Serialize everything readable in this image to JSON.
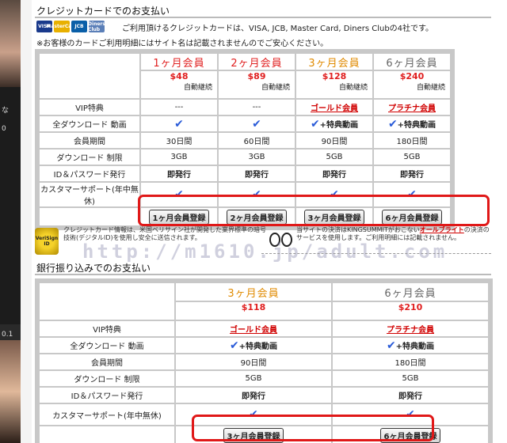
{
  "side": {
    "label_top": "な",
    "label_mid": "0",
    "label_bottom": "0.1"
  },
  "credit": {
    "title": "クレジットカードでのお支払い",
    "card_icons": [
      "VISA",
      "MasterCard",
      "JCB",
      "Diners Club"
    ],
    "intro1": "ご利用頂けるクレジットカードは、VISA, JCB, Master Card, Diners Clubの4社です。",
    "intro2": "※お客様のカードご利用明細にはサイト名は記載されませんのでご安心ください。",
    "plans": [
      {
        "name": "1ヶ月会員",
        "price": "$48",
        "auto": "自動継続",
        "color": "#e02020"
      },
      {
        "name": "2ヶ月会員",
        "price": "$89",
        "auto": "自動継続",
        "color": "#e02020"
      },
      {
        "name": "3ヶ月会員",
        "price": "$128",
        "auto": "自動継続",
        "color": "#e08a00"
      },
      {
        "name": "6ヶ月会員",
        "price": "$240",
        "auto": "自動継続",
        "color": "#666666"
      }
    ],
    "rows": {
      "vip": "VIP特典",
      "download": "全ダウンロード 動画",
      "period": "会員期間",
      "limit": "ダウンロード 制限",
      "id": "ID＆パスワード発行",
      "support": "カスタマーサポート(年中無休)"
    },
    "vip_values": [
      "---",
      "---",
      "ゴールド会員",
      "プラチナ会員"
    ],
    "download_extra": "+特典動画",
    "periods": [
      "30日間",
      "60日間",
      "90日間",
      "180日間"
    ],
    "limits": [
      "3GB",
      "3GB",
      "5GB",
      "5GB"
    ],
    "issue": "即発行",
    "buttons": [
      "1ヶ月会員登録",
      "2ヶ月会員登録",
      "3ヶ月会員登録",
      "6ヶ月会員登録"
    ]
  },
  "verify": {
    "badge": "VeriSign ID",
    "text1": "クレジットカード情報は、米国ベリサイン社が開発した業界標準の暗号技術(デジタルID)を使用し安全に送信されます。",
    "text2": "当サイトの決済はKINGSUMMITがおこない",
    "link": "オールブライト",
    "text3": "の決済のサービスを使用します。ご利用明細には記載されません。",
    "watermark": "http://m1610.jp/adult.com"
  },
  "bank": {
    "title": "銀行振り込みでのお支払い",
    "plans": [
      {
        "name": "3ヶ月会員",
        "price": "$118",
        "color": "#e08a00"
      },
      {
        "name": "6ヶ月会員",
        "price": "$210",
        "color": "#666666"
      }
    ],
    "vip_values": [
      "ゴールド会員",
      "プラチナ会員"
    ],
    "periods": [
      "90日間",
      "180日間"
    ],
    "limits": [
      "5GB",
      "5GB"
    ],
    "buttons": [
      "3ヶ月会員登録",
      "6ヶ月会員登録"
    ]
  },
  "colors": {
    "highlight": "#e01818",
    "check": "#2a5bd8",
    "table_border": "#c8c8c8"
  }
}
